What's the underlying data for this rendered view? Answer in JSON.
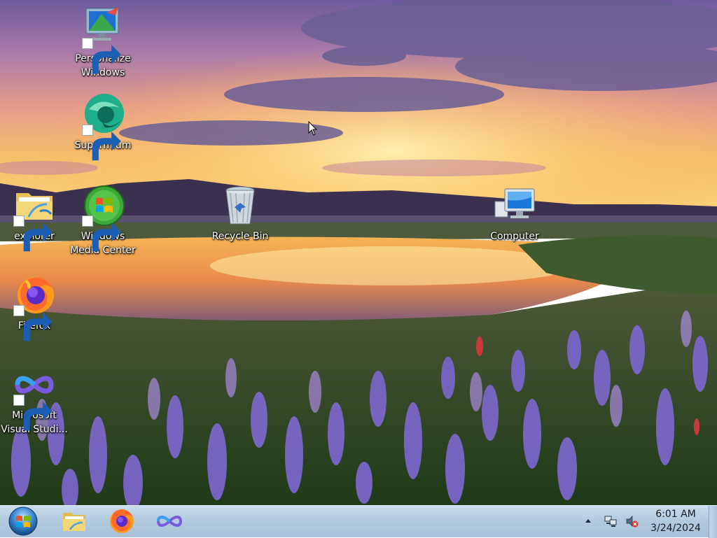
{
  "desktop": {
    "icons": [
      {
        "name": "personalize-windows",
        "label": "Personalize\nWindows"
      },
      {
        "name": "supermium",
        "label": "Supermium"
      },
      {
        "name": "explorer",
        "label": "explorer"
      },
      {
        "name": "windows-media-center",
        "label": "Windows\nMedia Center"
      },
      {
        "name": "recycle-bin",
        "label": "Recycle Bin"
      },
      {
        "name": "computer",
        "label": "Computer"
      },
      {
        "name": "firefox",
        "label": "Firefox"
      },
      {
        "name": "visual-studio",
        "label": "Microsoft\nVisual Studi..."
      }
    ]
  },
  "taskbar": {
    "start_icon": "windows-start-orb-icon",
    "pinned": [
      "file-explorer-icon",
      "firefox-icon",
      "visual-studio-icon"
    ],
    "tray_icons": [
      "show-hidden-icons-arrow",
      "network-icon",
      "volume-muted-icon"
    ],
    "clock": {
      "time": "6:01 AM",
      "date": "3/24/2024"
    }
  },
  "colors": {
    "taskbar": "#b3cadf",
    "label_text": "#ffffff"
  }
}
